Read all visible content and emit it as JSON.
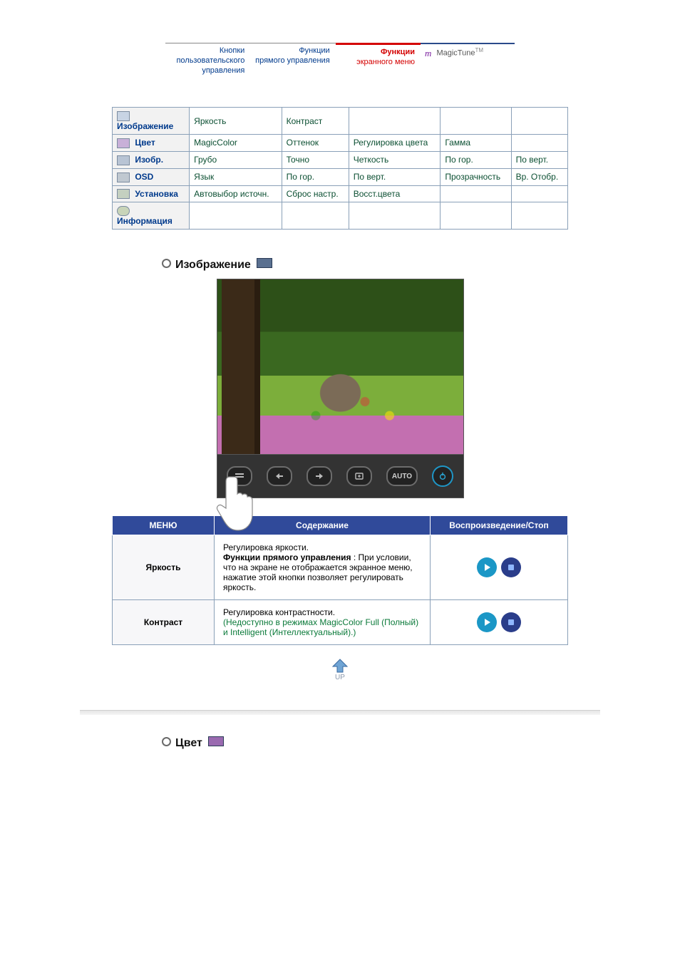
{
  "topnav": {
    "tabs": [
      {
        "line1": "Кнопки пользовательского",
        "line2": "управления"
      },
      {
        "line1": "Функции",
        "line2": "прямого управления"
      },
      {
        "line1": "Функции",
        "line2": "экранного меню"
      }
    ],
    "magictune": "MagicTune",
    "tm": "TM"
  },
  "grid": {
    "image": {
      "label": "Изображение",
      "cols": [
        "Яркость",
        "Контраст",
        "",
        "",
        ""
      ]
    },
    "color": {
      "label": "Цвет",
      "cols": [
        "MagicColor",
        "Оттенок",
        "Регулировка цвета",
        "Гамма",
        ""
      ]
    },
    "sizep": {
      "label": "Изобр.",
      "cols": [
        "Грубо",
        "Точно",
        "Четкость",
        "По гор.",
        "По верт."
      ]
    },
    "osd": {
      "label": "OSD",
      "cols": [
        "Язык",
        "По гор.",
        "По верт.",
        "Прозрачность",
        "Вр. Отобр."
      ]
    },
    "setup": {
      "label": "Установка",
      "cols": [
        "Автовыбор источн.",
        "Сброс настр.",
        "Восст.цвета",
        "",
        ""
      ]
    },
    "info": {
      "label": "Информация",
      "cols": [
        "",
        "",
        "",
        "",
        ""
      ]
    }
  },
  "section_image_title": "Изображение",
  "buttons_bar": {
    "auto": "AUTO"
  },
  "desc_headers": {
    "menu": "МЕНЮ",
    "content": "Содержание",
    "play": "Воспроизведение/Стоп"
  },
  "rows": {
    "brightness": {
      "name": "Яркость",
      "p1": "Регулировка яркости.",
      "p2a": "Функции прямого управления",
      "p2b": " : При условии, что на экране не отображается экранное меню, нажатие этой кнопки позволяет регулировать яркость."
    },
    "contrast": {
      "name": "Контраст",
      "p1": "Регулировка контрастности.",
      "note": "(Недоступно в режимах MagicColor Full (Полный) и Intelligent (Интеллектуальный).)"
    }
  },
  "up_label": "UP",
  "section_color_title": "Цвет"
}
